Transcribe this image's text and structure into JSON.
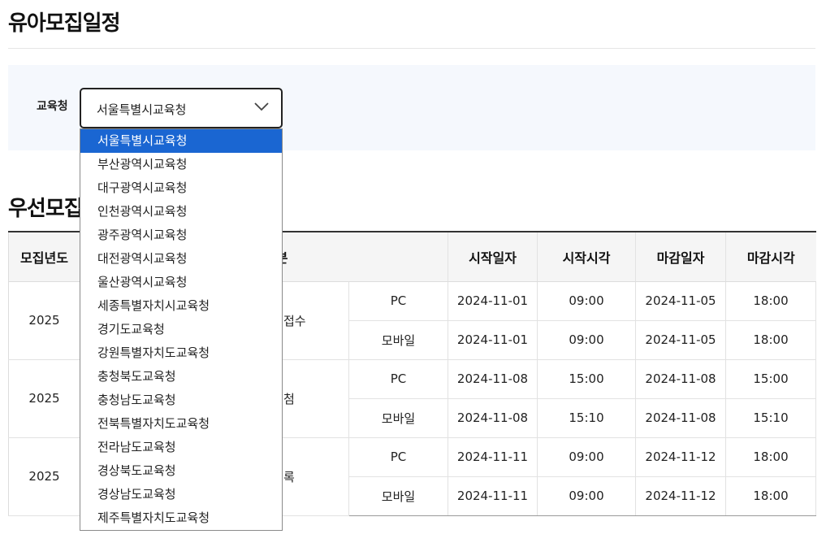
{
  "page": {
    "title": "유아모집일정"
  },
  "filter": {
    "label": "교육청",
    "selected_value": "서울특별시교육청",
    "options": [
      "서울특별시교육청",
      "부산광역시교육청",
      "대구광역시교육청",
      "인천광역시교육청",
      "광주광역시교육청",
      "대전광역시교육청",
      "울산광역시교육청",
      "세종특별자치시교육청",
      "경기도교육청",
      "강원특별자치도교육청",
      "충청북도교육청",
      "충청남도교육청",
      "전북특별자치도교육청",
      "전라남도교육청",
      "경상북도교육청",
      "경상남도교육청",
      "제주특별자치도교육청"
    ]
  },
  "section": {
    "title": "우선모집"
  },
  "table": {
    "headers": {
      "year": "모집년도",
      "schedule_type": "일정구분",
      "start_date": "시작일자",
      "start_time": "시작시각",
      "end_date": "마감일자",
      "end_time": "마감시각"
    },
    "groups": [
      {
        "year": "2025",
        "type_visible": "접수",
        "rows": [
          {
            "channel": "PC",
            "start_date": "2024-11-01",
            "start_time": "09:00",
            "end_date": "2024-11-05",
            "end_time": "18:00"
          },
          {
            "channel": "모바일",
            "start_date": "2024-11-01",
            "start_time": "09:00",
            "end_date": "2024-11-05",
            "end_time": "18:00"
          }
        ]
      },
      {
        "year": "2025",
        "type_visible": "첨",
        "rows": [
          {
            "channel": "PC",
            "start_date": "2024-11-08",
            "start_time": "15:00",
            "end_date": "2024-11-08",
            "end_time": "15:00"
          },
          {
            "channel": "모바일",
            "start_date": "2024-11-08",
            "start_time": "15:10",
            "end_date": "2024-11-08",
            "end_time": "15:10"
          }
        ]
      },
      {
        "year": "2025",
        "type_visible": "록",
        "rows": [
          {
            "channel": "PC",
            "start_date": "2024-11-11",
            "start_time": "09:00",
            "end_date": "2024-11-12",
            "end_time": "18:00"
          },
          {
            "channel": "모바일",
            "start_date": "2024-11-11",
            "start_time": "09:00",
            "end_date": "2024-11-12",
            "end_time": "18:00"
          }
        ]
      }
    ]
  },
  "colors": {
    "selected_option_bg": "#1a66d2",
    "filter_panel_bg": "#f5f8fd",
    "table_header_bg": "#f5f5f5"
  }
}
